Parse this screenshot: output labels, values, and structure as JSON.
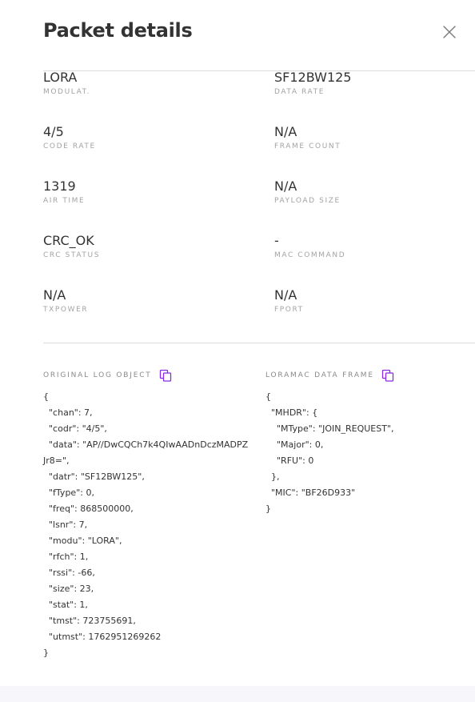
{
  "header": {
    "title": "Packet details"
  },
  "fields": [
    {
      "value": "LORA",
      "label": "MODULAT."
    },
    {
      "value": "SF12BW125",
      "label": "DATA RATE"
    },
    {
      "value": "4/5",
      "label": "CODE RATE"
    },
    {
      "value": "N/A",
      "label": "FRAME COUNT"
    },
    {
      "value": "1319",
      "label": "AIR TIME"
    },
    {
      "value": "N/A",
      "label": "PAYLOAD SIZE"
    },
    {
      "value": "CRC_OK",
      "label": "CRC STATUS"
    },
    {
      "value": "-",
      "label": "MAC COMMAND"
    },
    {
      "value": "N/A",
      "label": "TXPOWER"
    },
    {
      "value": "N/A",
      "label": "FPORT"
    }
  ],
  "original_log": {
    "title": "ORIGINAL LOG OBJECT",
    "lines": [
      "{",
      "  \"chan\": 7,",
      "  \"codr\": \"4/5\",",
      "  \"data\": \"AP//DwCQCh7k4QIwAADnDczMADPZ",
      "Jr8=\",",
      "  \"datr\": \"SF12BW125\",",
      "  \"fType\": 0,",
      "  \"freq\": 868500000,",
      "  \"lsnr\": 7,",
      "  \"modu\": \"LORA\",",
      "  \"rfch\": 1,",
      "  \"rssi\": -66,",
      "  \"size\": 23,",
      "  \"stat\": 1,",
      "  \"tmst\": 723755691,",
      "  \"utmst\": 1762951269262",
      "}"
    ]
  },
  "loramac_frame": {
    "title": "LORAMAC DATA FRAME",
    "lines": [
      "{",
      "  \"MHDR\": {",
      "    \"MType\": \"JOIN_REQUEST\",",
      "    \"Major\": 0,",
      "    \"RFU\": 0",
      "  },",
      "  \"MIC\": \"BF26D933\"",
      "}"
    ]
  },
  "colors": {
    "accent": "#8a2be2",
    "label": "#a3a3a3",
    "text": "#333333",
    "divider": "#dcdce0"
  }
}
